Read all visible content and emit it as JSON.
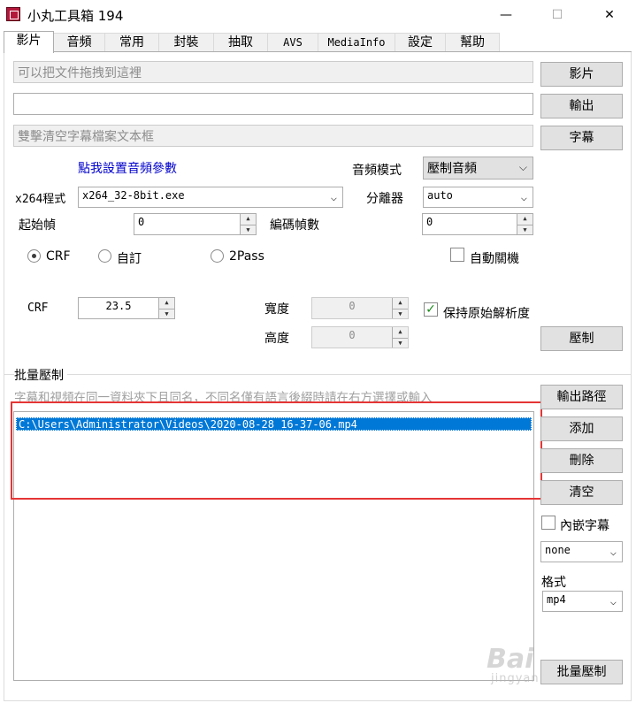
{
  "window": {
    "title": "小丸工具箱 194",
    "minimize": "—",
    "maximize": "☐",
    "close": "✕"
  },
  "tabs": [
    "影片",
    "音頻",
    "常用",
    "封裝",
    "抽取",
    "AVS",
    "MediaInfo",
    "設定",
    "幫助"
  ],
  "video": {
    "input_placeholder": "可以把文件拖拽到這裡",
    "output_value": "",
    "subtitle_placeholder": "雙擊清空字幕檔案文本框",
    "video_button": "影片",
    "output_button": "輸出",
    "subtitle_button": "字幕",
    "audio_settings_link": "點我設置音頻參數",
    "audio_mode_label": "音頻模式",
    "audio_mode_value": "壓制音頻",
    "x264_label": "x264程式",
    "x264_value": "x264_32-8bit.exe",
    "splitter_label": "分離器",
    "splitter_value": "auto",
    "start_frame_label": "起始幀",
    "start_frame_value": "0",
    "encode_frames_label": "編碼幀數",
    "encode_frames_value": "0",
    "radio_crf": "CRF",
    "radio_custom": "自訂",
    "radio_2pass": "2Pass",
    "auto_shutdown_label": "自動關機",
    "crf_label": "CRF",
    "crf_value": "23.5",
    "width_label": "寬度",
    "width_value": "0",
    "height_label": "高度",
    "height_value": "0",
    "keep_resolution_label": "保持原始解析度",
    "keep_resolution_checked": "✓",
    "encode_button": "壓制"
  },
  "batch": {
    "group_label": "批量壓制",
    "hint": "字幕和視頻在同一資料夾下且同名，不同名僅有語言後綴時請在右方選擇或輸入",
    "files": [
      "C:\\Users\\Administrator\\Videos\\2020-08-28 16-37-06.mp4"
    ],
    "output_path_button": "輸出路徑",
    "add_button": "添加",
    "delete_button": "刪除",
    "clear_button": "清空",
    "embed_subtitle_label": "內嵌字幕",
    "subtitle_lang_value": "none",
    "format_label": "格式",
    "format_value": "mp4",
    "batch_encode_button": "批量壓制"
  },
  "watermark": {
    "text": "Bai",
    "sub": "jingyan"
  }
}
